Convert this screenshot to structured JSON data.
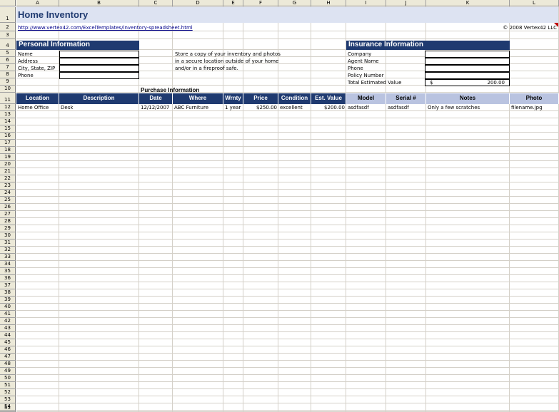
{
  "columns": [
    "A",
    "B",
    "C",
    "D",
    "E",
    "F",
    "G",
    "H",
    "I",
    "J",
    "K",
    "L"
  ],
  "title": "Home Inventory",
  "url": "http://www.vertex42.com/ExcelTemplates/inventory-spreadsheet.html",
  "copyright": "© 2008 Vertex42 LLC",
  "personal": {
    "header": "Personal Information",
    "fields": [
      "Name",
      "Address",
      "City, State, ZIP",
      "Phone"
    ]
  },
  "note": {
    "line1": "Store a copy of your inventory and photos",
    "line2": "in a secure location outside of your home",
    "line3": "and/or in a fireproof safe."
  },
  "insurance": {
    "header": "Insurance Information",
    "fields": [
      "Company",
      "Agent Name",
      "Phone",
      "Policy Number",
      "Total Estimated Value"
    ],
    "total_currency": "$",
    "total_value": "200.00"
  },
  "purchase_label": "Purchase Information",
  "table": {
    "headers": [
      "Location",
      "Description",
      "Date",
      "Where",
      "Wrnty",
      "Price",
      "Condition",
      "Est. Value",
      "Model",
      "Serial #",
      "Notes",
      "Photo"
    ],
    "rows": [
      [
        "Home Office",
        "Desk",
        "12/12/2007",
        "ABC Furniture",
        "1 year",
        "$250.00",
        "excellent",
        "$200.00",
        "asdfasdf",
        "asdfasdf",
        "Only a few scratches",
        "filename.jpg"
      ]
    ]
  }
}
